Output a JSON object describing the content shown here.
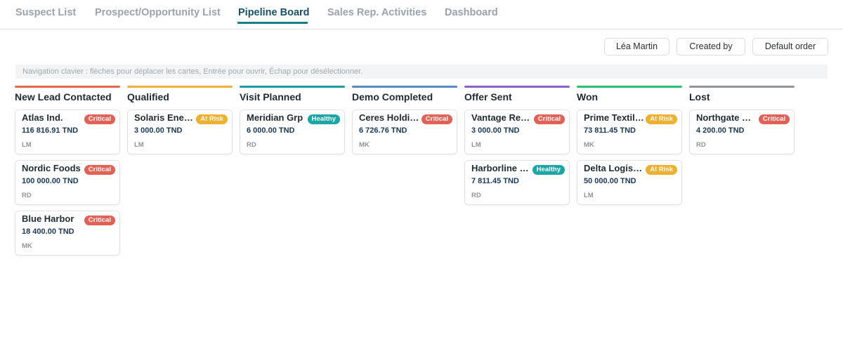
{
  "tabs": [
    {
      "label": "Suspect List"
    },
    {
      "label": "Prospect/Opportunity List"
    },
    {
      "label": "Pipeline Board"
    },
    {
      "label": "Sales Rep. Activities"
    },
    {
      "label": "Dashboard"
    }
  ],
  "active_tab": "Pipeline Board",
  "filters": {
    "rep": "Léa Martin",
    "sort_by": "Created by",
    "order": "Default order"
  },
  "hint": "Navigation clavier : flèches pour déplacer les cartes, Entrée pour ouvrir, Échap pour désélectionner.",
  "status_colors": {
    "Critical": "#e45f56",
    "At Risk": "#efb02e",
    "Healthy": "#1aa6a6"
  },
  "columns": [
    {
      "title": "New Lead Contacted",
      "color": "#e36a4f",
      "cards": [
        {
          "name": "Atlas Ind.",
          "status": "Critical",
          "amount": "116 816.91 TND",
          "owner": "LM"
        },
        {
          "name": "Nordic Foods",
          "status": "Critical",
          "amount": "100 000.00 TND",
          "owner": "RD"
        },
        {
          "name": "Blue Harbor",
          "status": "Critical",
          "amount": "18 400.00 TND",
          "owner": "MK"
        }
      ]
    },
    {
      "title": "Qualified",
      "color": "#efb13a",
      "cards": [
        {
          "name": "Solaris Energy",
          "status": "At Risk",
          "amount": "3 000.00 TND",
          "owner": "LM"
        }
      ]
    },
    {
      "title": "Visit Planned",
      "color": "#1a9aa0",
      "cards": [
        {
          "name": "Meridian Grp",
          "status": "Healthy",
          "amount": "6 000.00 TND",
          "owner": "RD"
        }
      ]
    },
    {
      "title": "Demo Completed",
      "color": "#5b86c4",
      "cards": [
        {
          "name": "Ceres Holding",
          "status": "Critical",
          "amount": "6 726.76 TND",
          "owner": "MK"
        }
      ]
    },
    {
      "title": "Offer Sent",
      "color": "#8a62c9",
      "cards": [
        {
          "name": "Vantage Retail",
          "status": "Critical",
          "amount": "3 000.00 TND",
          "owner": "LM"
        },
        {
          "name": "Harborline Logistics",
          "status": "Healthy",
          "amount": "7 811.45 TND",
          "owner": "RD"
        }
      ]
    },
    {
      "title": "Won",
      "color": "#2cc172",
      "cards": [
        {
          "name": "Prime Textiles",
          "status": "At Risk",
          "amount": "73 811.45 TND",
          "owner": "MK"
        },
        {
          "name": "Delta Logistics",
          "status": "At Risk",
          "amount": "50 000.00 TND",
          "owner": "LM"
        }
      ]
    },
    {
      "title": "Lost",
      "color": "#8f959a",
      "cards": [
        {
          "name": "Northgate Resources",
          "status": "Critical",
          "amount": "4 200.00 TND",
          "owner": "RD"
        }
      ]
    }
  ]
}
